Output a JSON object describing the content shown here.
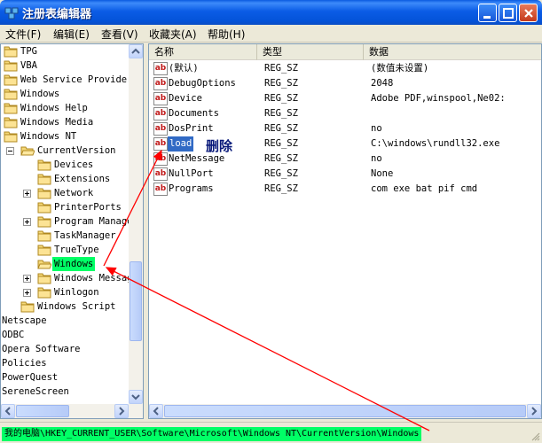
{
  "window": {
    "title": "注册表编辑器"
  },
  "menu": [
    {
      "label": "文件(F)"
    },
    {
      "label": "编辑(E)"
    },
    {
      "label": "查看(V)"
    },
    {
      "label": "收藏夹(A)"
    },
    {
      "label": "帮助(H)"
    }
  ],
  "tree": {
    "items": [
      {
        "label": "TPG"
      },
      {
        "label": "VBA"
      },
      {
        "label": "Web Service Providers"
      },
      {
        "label": "Windows"
      },
      {
        "label": "Windows Help"
      },
      {
        "label": "Windows Media"
      },
      {
        "label": "Windows NT"
      },
      {
        "label": "CurrentVersion"
      },
      {
        "label": "Devices"
      },
      {
        "label": "Extensions"
      },
      {
        "label": "Network"
      },
      {
        "label": "PrinterPorts"
      },
      {
        "label": "Program Manager"
      },
      {
        "label": "TaskManager"
      },
      {
        "label": "TrueType"
      },
      {
        "label": "Windows"
      },
      {
        "label": "Windows Messaging"
      },
      {
        "label": "Winlogon"
      },
      {
        "label": "Windows Script"
      },
      {
        "label": "Netscape"
      },
      {
        "label": "ODBC"
      },
      {
        "label": "Opera Software"
      },
      {
        "label": "Policies"
      },
      {
        "label": "PowerQuest"
      },
      {
        "label": "SereneScreen"
      }
    ]
  },
  "list": {
    "columns": {
      "name": "名称",
      "type": "类型",
      "data": "数据"
    },
    "rows": [
      {
        "name": "(默认)",
        "type": "REG_SZ",
        "data": "(数值未设置)"
      },
      {
        "name": "DebugOptions",
        "type": "REG_SZ",
        "data": "2048"
      },
      {
        "name": "Device",
        "type": "REG_SZ",
        "data": "Adobe PDF,winspool,Ne02:"
      },
      {
        "name": "Documents",
        "type": "REG_SZ",
        "data": ""
      },
      {
        "name": "DosPrint",
        "type": "REG_SZ",
        "data": "no"
      },
      {
        "name": "load",
        "type": "REG_SZ",
        "data": "C:\\windows\\rundll32.exe"
      },
      {
        "name": "NetMessage",
        "type": "REG_SZ",
        "data": "no"
      },
      {
        "name": "NullPort",
        "type": "REG_SZ",
        "data": "None"
      },
      {
        "name": "Programs",
        "type": "REG_SZ",
        "data": "com exe bat pif cmd"
      }
    ],
    "annotation": "删除"
  },
  "status": {
    "path": "我的电脑\\HKEY_CURRENT_USER\\Software\\Microsoft\\Windows NT\\CurrentVersion\\Windows"
  },
  "colors": {
    "highlight": "#00ff66",
    "arrow": "#ff0000",
    "selection": "#316ac5"
  }
}
